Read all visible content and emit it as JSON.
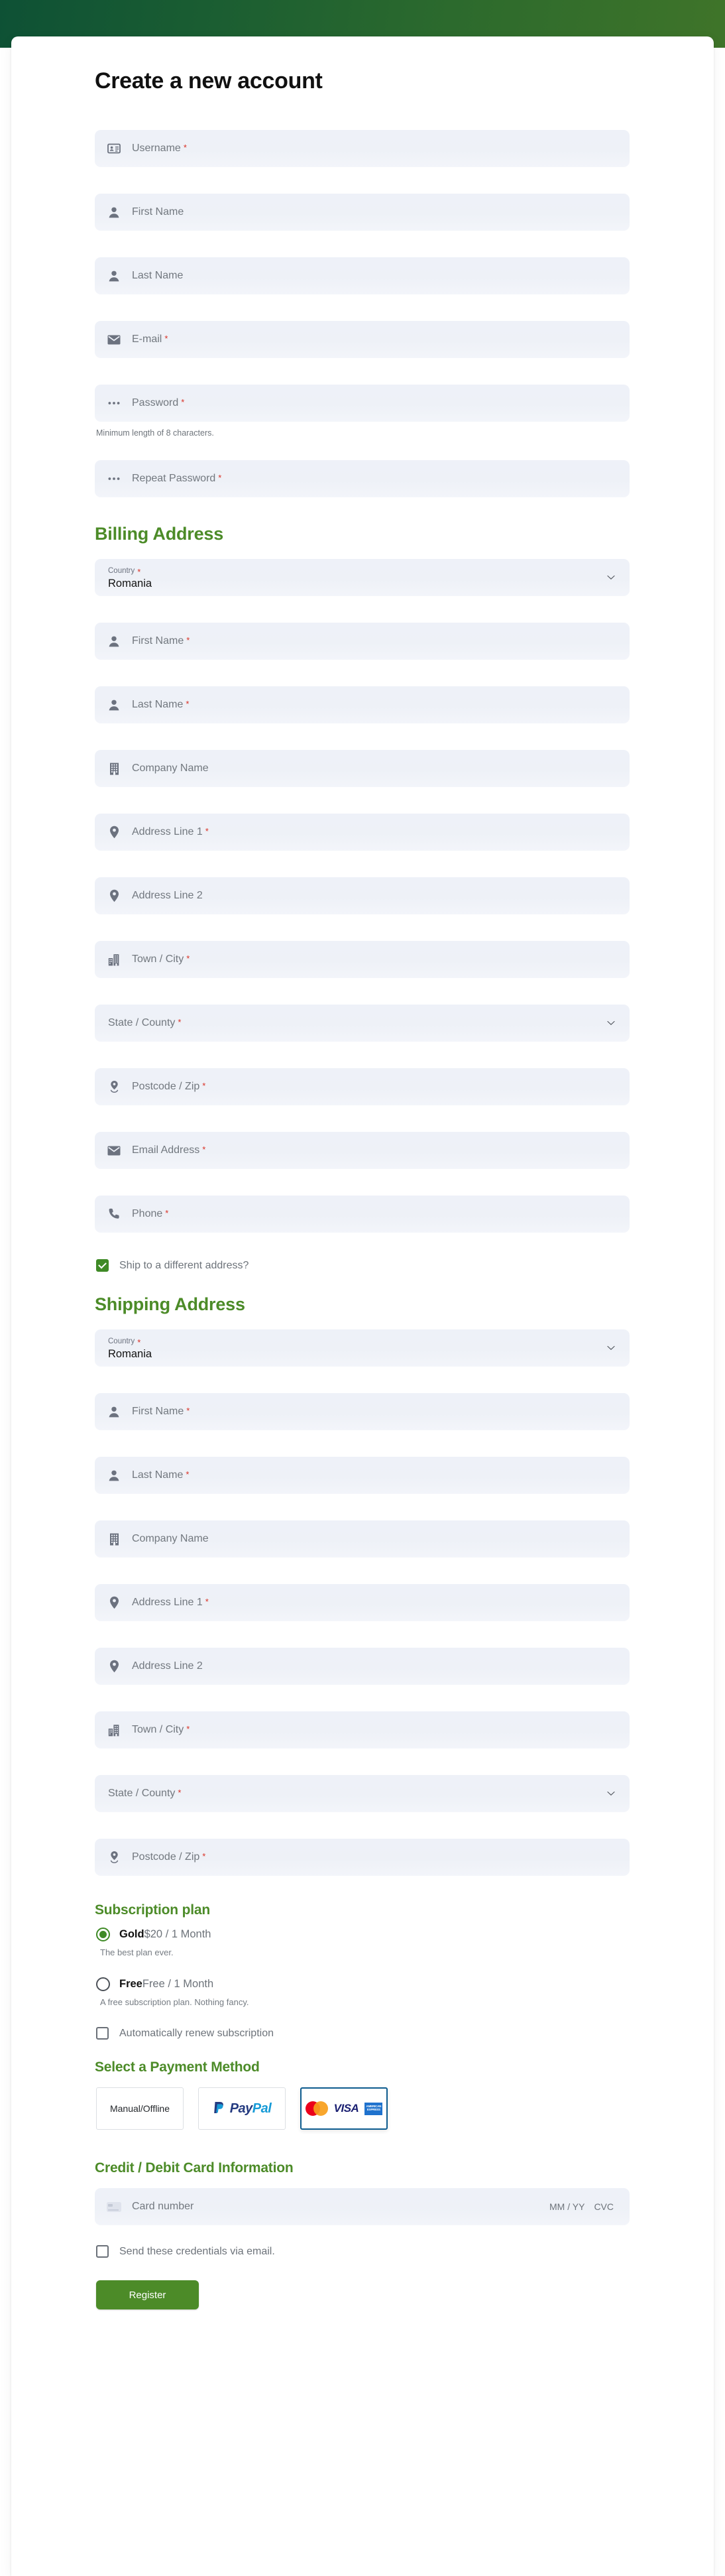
{
  "page": {
    "title": "Create a new account",
    "required_mark": "*"
  },
  "account": {
    "fields": [
      {
        "icon": "id-card-icon",
        "name": "username",
        "placeholder": "Username",
        "required": true
      },
      {
        "icon": "person-icon",
        "name": "first-name",
        "placeholder": "First Name",
        "required": false
      },
      {
        "icon": "person-icon",
        "name": "last-name",
        "placeholder": "Last Name",
        "required": false
      },
      {
        "icon": "envelope-icon",
        "name": "email",
        "placeholder": "E-mail",
        "required": true
      },
      {
        "icon": "dots-icon",
        "name": "password",
        "placeholder": "Password",
        "required": true
      },
      {
        "icon": "dots-icon",
        "name": "repeat-password",
        "placeholder": "Repeat Password",
        "required": true
      }
    ],
    "password_helper": "Minimum length of 8 characters."
  },
  "billing": {
    "heading": "Billing Address",
    "country": {
      "label": "Country",
      "value": "Romania",
      "required": true
    },
    "fields": [
      {
        "icon": "person-icon",
        "name": "first-name",
        "placeholder": "First Name",
        "required": true
      },
      {
        "icon": "person-icon",
        "name": "last-name",
        "placeholder": "Last Name",
        "required": true
      },
      {
        "icon": "building-icon",
        "name": "company-name",
        "placeholder": "Company Name",
        "required": false
      },
      {
        "icon": "map-pin-icon",
        "name": "address-line-1",
        "placeholder": "Address Line 1",
        "required": true
      },
      {
        "icon": "map-pin-icon",
        "name": "address-line-2",
        "placeholder": "Address Line 2",
        "required": false
      },
      {
        "icon": "city-icon",
        "name": "town-city",
        "placeholder": "Town / City",
        "required": true
      },
      {
        "icon": "none",
        "name": "state-county",
        "placeholder": "State / County",
        "required": true,
        "select": true
      },
      {
        "icon": "postcode-pin-icon",
        "name": "postcode-zip",
        "placeholder": "Postcode / Zip",
        "required": true
      },
      {
        "icon": "envelope-icon",
        "name": "email-address",
        "placeholder": "Email Address",
        "required": true
      },
      {
        "icon": "phone-icon",
        "name": "phone",
        "placeholder": "Phone",
        "required": true
      }
    ],
    "ship_different": {
      "label": "Ship to a different address?",
      "checked": true
    }
  },
  "shipping": {
    "heading": "Shipping Address",
    "country": {
      "label": "Country",
      "value": "Romania",
      "required": true
    },
    "fields": [
      {
        "icon": "person-icon",
        "name": "first-name",
        "placeholder": "First Name",
        "required": true
      },
      {
        "icon": "person-icon",
        "name": "last-name",
        "placeholder": "Last Name",
        "required": true
      },
      {
        "icon": "building-icon",
        "name": "company-name",
        "placeholder": "Company Name",
        "required": false
      },
      {
        "icon": "map-pin-icon",
        "name": "address-line-1",
        "placeholder": "Address Line 1",
        "required": true
      },
      {
        "icon": "map-pin-icon",
        "name": "address-line-2",
        "placeholder": "Address Line 2",
        "required": false
      },
      {
        "icon": "city-icon",
        "name": "town-city",
        "placeholder": "Town / City",
        "required": true
      },
      {
        "icon": "none",
        "name": "state-county",
        "placeholder": "State / County",
        "required": true,
        "select": true
      },
      {
        "icon": "postcode-pin-icon",
        "name": "postcode-zip",
        "placeholder": "Postcode / Zip",
        "required": true
      }
    ]
  },
  "subscription": {
    "heading": "Subscription plan",
    "plans": [
      {
        "name": "Gold",
        "price": "$20 / 1 Month",
        "description": "The best plan ever.",
        "selected": true
      },
      {
        "name": "Free",
        "price": "Free / 1 Month",
        "description": "A free subscription plan. Nothing fancy.",
        "selected": false
      }
    ],
    "auto_renew": {
      "label": "Automatically renew subscription",
      "checked": false
    }
  },
  "payment": {
    "heading": "Select a Payment Method",
    "methods": [
      {
        "name": "manual-offline",
        "label": "Manual/Offline",
        "selected": false
      },
      {
        "name": "paypal",
        "label": "PayPal",
        "selected": false
      },
      {
        "name": "credit-card",
        "label": "Credit Card",
        "selected": true
      }
    ],
    "card_section_heading": "Credit / Debit Card Information",
    "card_number_placeholder": "Card number",
    "expiry_placeholder": "MM / YY",
    "cvc_placeholder": "CVC",
    "send_credentials": {
      "label": "Send these credentials via email.",
      "checked": false
    },
    "brands": {
      "visa": "VISA",
      "amex": "AMERICAN EXPRESS"
    }
  },
  "submit": {
    "label": "Register"
  },
  "colors": {
    "header_gradient_start": "#0e5135",
    "header_gradient_end": "#3f7429",
    "accent_green": "#4c8b28",
    "button_green": "#4c8b28",
    "required_red": "#d93025",
    "field_bg": "#eef1f8",
    "selected_border": "#0e5c8f"
  }
}
